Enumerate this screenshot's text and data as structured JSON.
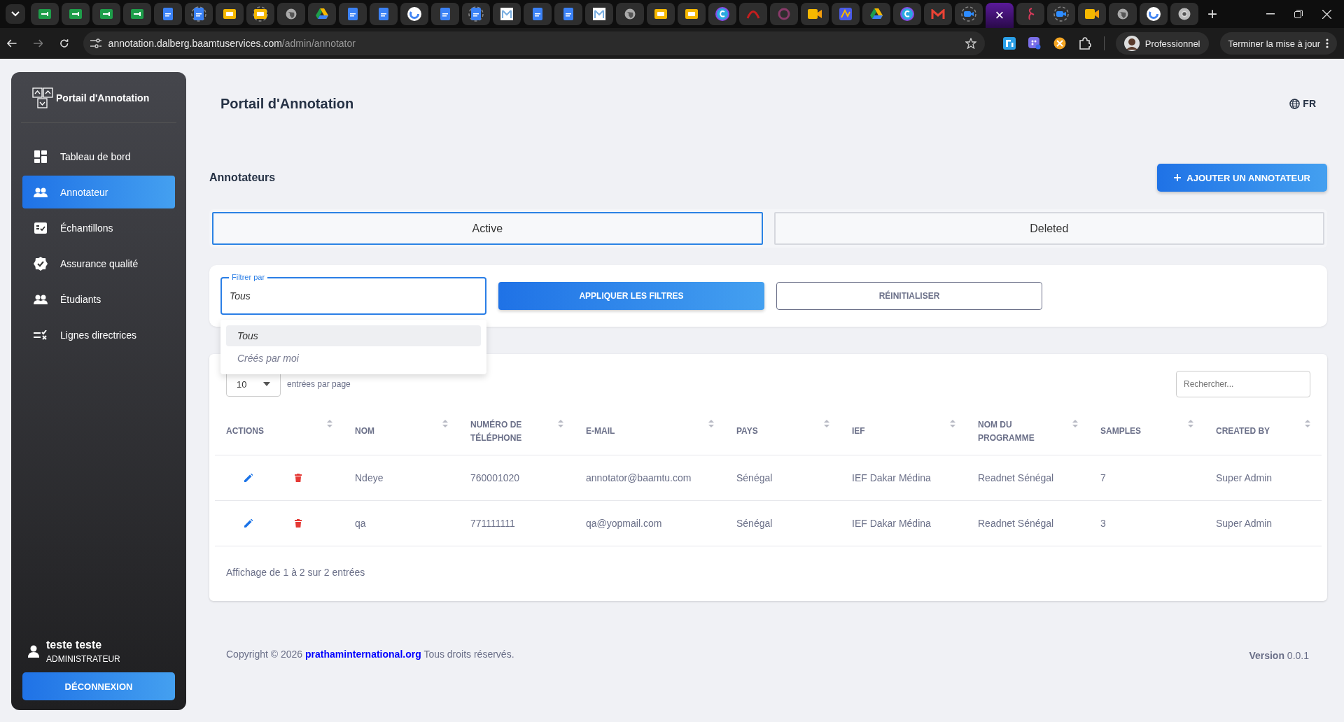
{
  "browser": {
    "tabs": [
      {
        "selected": false
      },
      {
        "selected": false
      },
      {
        "selected": false
      },
      {
        "selected": false
      },
      {
        "selected": false
      },
      {
        "selected": false
      },
      {
        "selected": false
      },
      {
        "selected": false
      },
      {
        "selected": false
      },
      {
        "selected": false
      },
      {
        "selected": false
      },
      {
        "selected": false
      },
      {
        "selected": false
      },
      {
        "selected": false
      },
      {
        "selected": false
      },
      {
        "selected": false
      },
      {
        "selected": false
      },
      {
        "selected": false
      },
      {
        "selected": false
      },
      {
        "selected": false
      },
      {
        "selected": false
      },
      {
        "selected": false
      },
      {
        "selected": false
      },
      {
        "selected": false
      },
      {
        "selected": false
      },
      {
        "selected": false
      },
      {
        "selected": false
      },
      {
        "selected": false
      },
      {
        "selected": false
      },
      {
        "selected": false
      },
      {
        "selected": false
      },
      {
        "selected": true,
        "close": "×"
      },
      {
        "selected": false
      },
      {
        "selected": false
      },
      {
        "selected": false
      },
      {
        "selected": false
      },
      {
        "selected": false
      },
      {
        "selected": false
      }
    ],
    "new_tab": "+",
    "url_host": "annotation.dalberg.baamtuservices.com",
    "url_path": "/admin/annotator",
    "profile": "Professionnel",
    "update": "Terminer la mise à jour"
  },
  "sidebar": {
    "brand": "Portail d'Annotation",
    "items": [
      {
        "label": "Tableau de bord",
        "selected": false
      },
      {
        "label": "Annotateur",
        "selected": true
      },
      {
        "label": "Échantillons",
        "selected": false
      },
      {
        "label": "Assurance qualité",
        "selected": false
      },
      {
        "label": "Étudiants",
        "selected": false
      },
      {
        "label": "Lignes directrices",
        "selected": false
      }
    ],
    "user": {
      "name": "teste teste",
      "role": "ADMINISTRATEUR"
    },
    "logout": "DÉCONNEXION"
  },
  "header": {
    "title": "Portail d'Annotation",
    "language": "FR"
  },
  "section": {
    "title": "Annotateurs",
    "add_button": "AJOUTER UN ANNOTATEUR"
  },
  "status_tabs": [
    {
      "label": "Active",
      "selected": true
    },
    {
      "label": "Deleted",
      "selected": false
    }
  ],
  "filter": {
    "label": "Filtrer par",
    "value": "Tous",
    "options": [
      {
        "label": "Tous",
        "selected": true
      },
      {
        "label": "Créés par moi",
        "selected": false
      }
    ],
    "apply": "APPLIQUER LES FILTRES",
    "reset": "RÉINITIALISER"
  },
  "table": {
    "page_size": "10",
    "page_size_label": "entrées par page",
    "search": {
      "placeholder": "Rechercher..."
    },
    "actions_column": "ACTIONS",
    "columns": [
      "NOM",
      "NUMÉRO DE TÉLÉPHONE",
      "E-MAIL",
      "PAYS",
      "IEF",
      "NOM DU PROGRAMME",
      "SAMPLES",
      "CREATED BY"
    ],
    "rows": [
      [
        "Ndeye",
        "760001020",
        "annotator@baamtu.com",
        "Sénégal",
        "IEF Dakar Médina",
        "Readnet Sénégal",
        "7",
        "Super Admin"
      ],
      [
        "qa",
        "771111111",
        "qa@yopmail.com",
        "Sénégal",
        "IEF Dakar Médina",
        "Readnet Sénégal",
        "3",
        "Super Admin"
      ]
    ],
    "summary": "Affichage de 1 à 2 sur 2 entrées"
  },
  "footer": {
    "prefix": "Copyright © 2026",
    "link": "prathaminternational.org",
    "suffix": "Tous droits réservés.",
    "version": "**Version** 0.0.1"
  }
}
